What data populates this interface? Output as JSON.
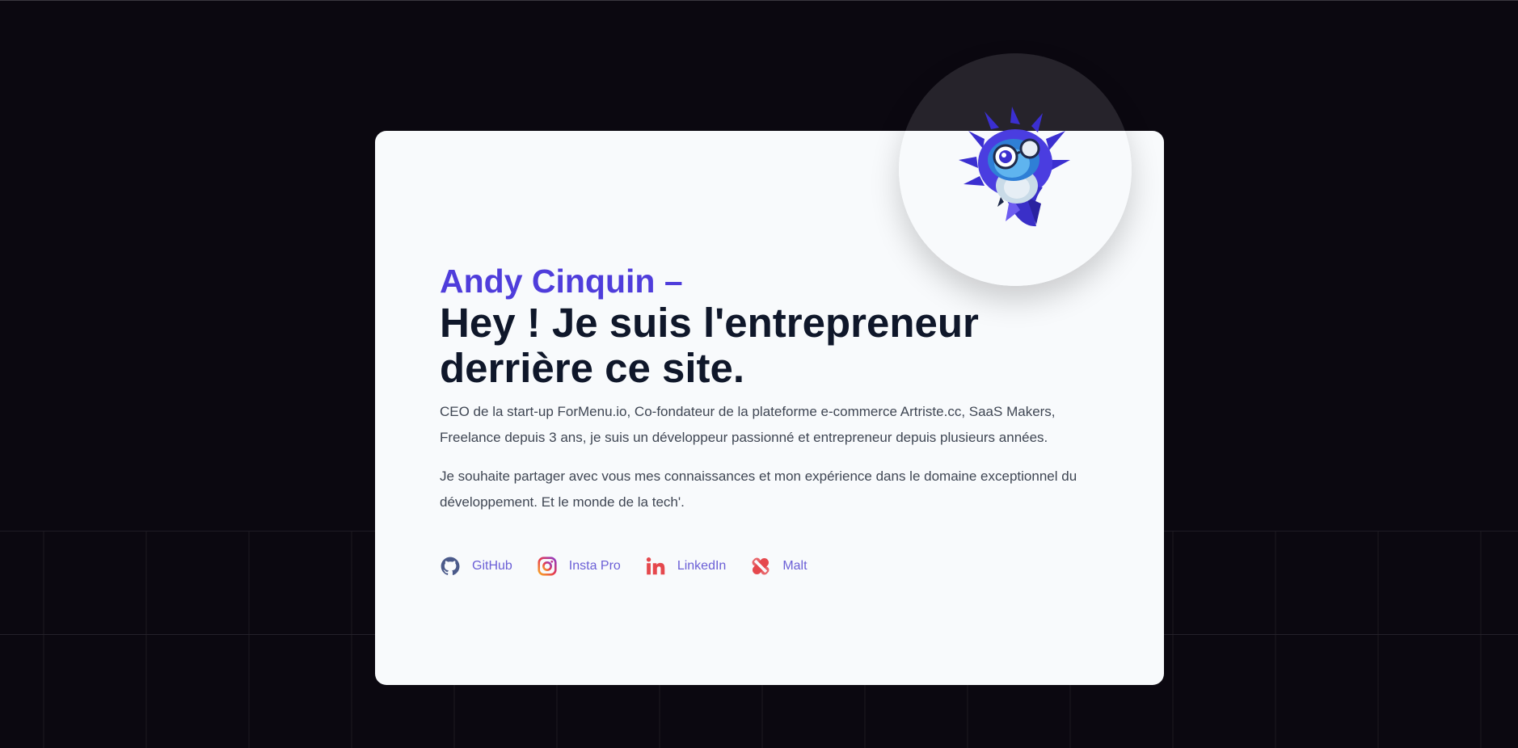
{
  "hero": {
    "name": "Andy Cinquin –",
    "headline": "Hey ! Je suis l'entrepreneur derrière ce site.",
    "paragraphs": [
      "CEO de la start-up ForMenu.io, Co-fondateur de la plateforme e-commerce Artriste.cc, SaaS Makers, Freelance depuis 3 ans, je suis un développeur passionné et entrepreneur depuis plusieurs années.",
      "Je souhaite partager avec vous mes connaissances et mon expérience dans le domaine exceptionnel du développement. Et le monde de la tech'."
    ],
    "avatar_icon": "owl-mascot-icon"
  },
  "socials": [
    {
      "label": "GitHub",
      "icon": "github-icon"
    },
    {
      "label": "Insta Pro",
      "icon": "instagram-icon"
    },
    {
      "label": "LinkedIn",
      "icon": "linkedin-icon"
    },
    {
      "label": "Malt",
      "icon": "malt-icon"
    }
  ],
  "colors": {
    "background": "#0b0810",
    "card": "#f8fafc",
    "accent": "#4f3ddb",
    "heading": "#0f172a",
    "body_text": "#3f4653",
    "link": "#6b5fd6"
  }
}
